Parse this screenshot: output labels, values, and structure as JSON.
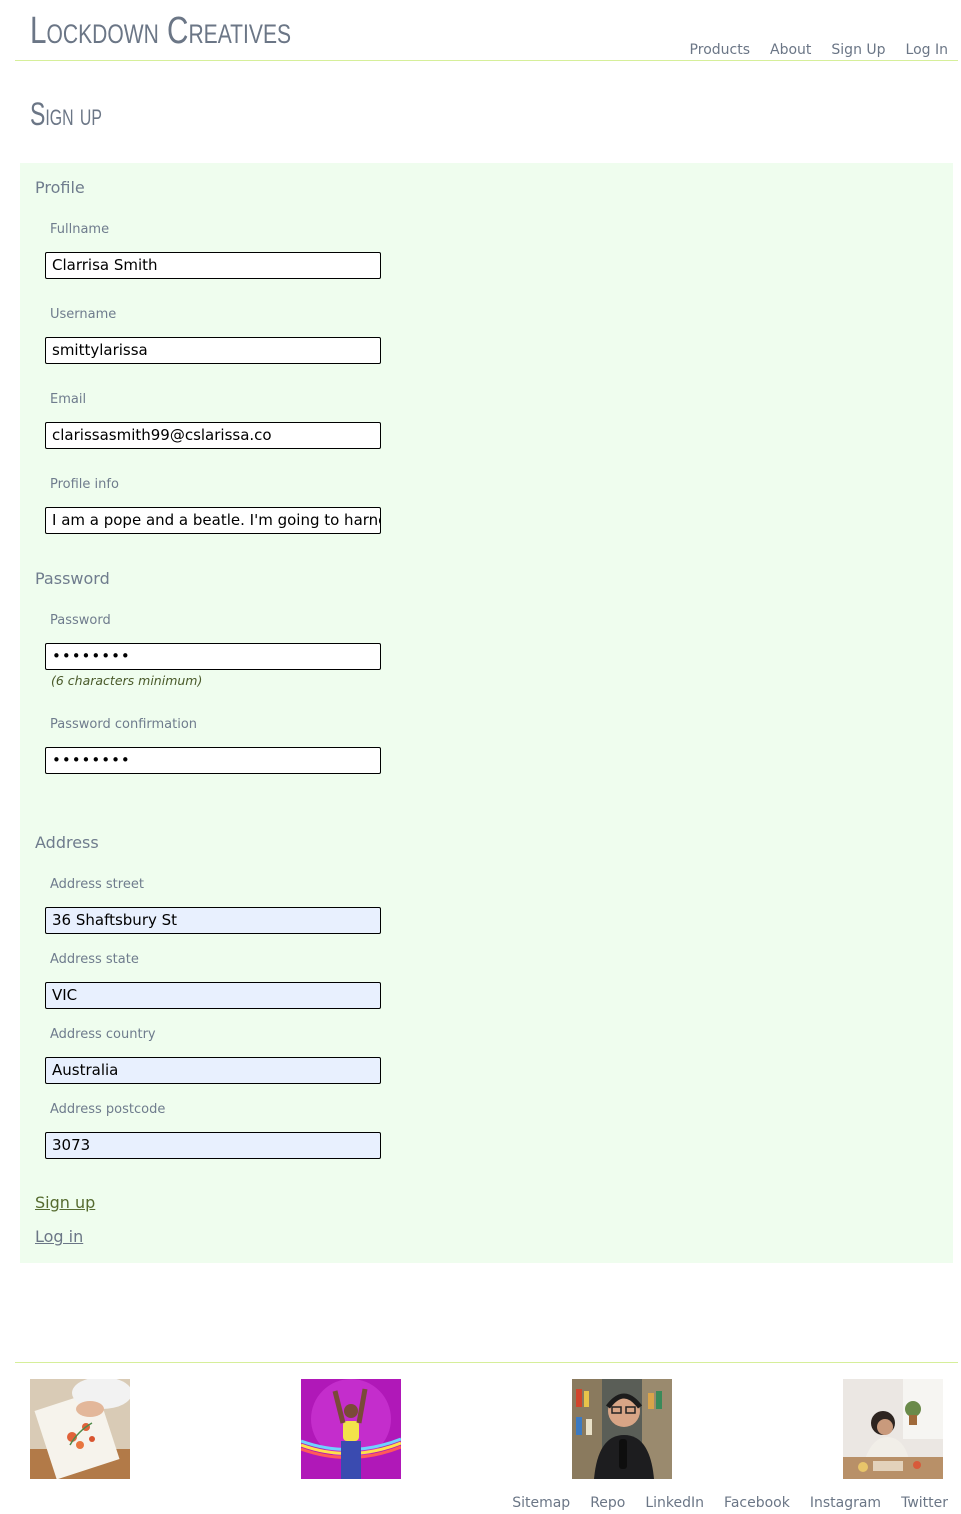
{
  "brand": {
    "name": "Lockdown Creatives"
  },
  "nav": {
    "items": [
      "Products",
      "About",
      "Sign Up",
      "Log In"
    ]
  },
  "page": {
    "title": "Sign up"
  },
  "form": {
    "profile": {
      "heading": "Profile",
      "fullname_label": "Fullname",
      "fullname_value": "Clarrisa Smith",
      "username_label": "Username",
      "username_value": "smittylarissa",
      "email_label": "Email",
      "email_value": "clarissasmith99@cslarissa.co",
      "info_label": "Profile info",
      "info_value": "I am a pope and a beatle. I'm going to harness"
    },
    "password": {
      "heading": "Password",
      "password_label": "Password",
      "password_value": "••••••••",
      "hint": "(6 characters minimum)",
      "confirm_label": "Password confirmation",
      "confirm_value": "••••••••"
    },
    "address": {
      "heading": "Address",
      "street_label": "Address street",
      "street_value": "36 Shaftsbury St",
      "state_label": "Address state",
      "state_value": "VIC",
      "country_label": "Address country",
      "country_value": "Australia",
      "postcode_label": "Address postcode",
      "postcode_value": "3073"
    },
    "signup_link": "Sign up",
    "login_link": "Log in"
  },
  "footer": {
    "images": [
      "painting-hands-photo",
      "dancer-neon-photo",
      "podcaster-photo",
      "woman-crafting-photo"
    ],
    "links": [
      "Sitemap",
      "Repo",
      "LinkedIn",
      "Facebook",
      "Instagram",
      "Twitter"
    ]
  },
  "colors": {
    "panel_bg": "#effdee",
    "divider": "#d6ef9a",
    "autofill_bg": "#e8f0fe",
    "primary_link": "#556b2f",
    "text_muted": "#6b7686"
  }
}
